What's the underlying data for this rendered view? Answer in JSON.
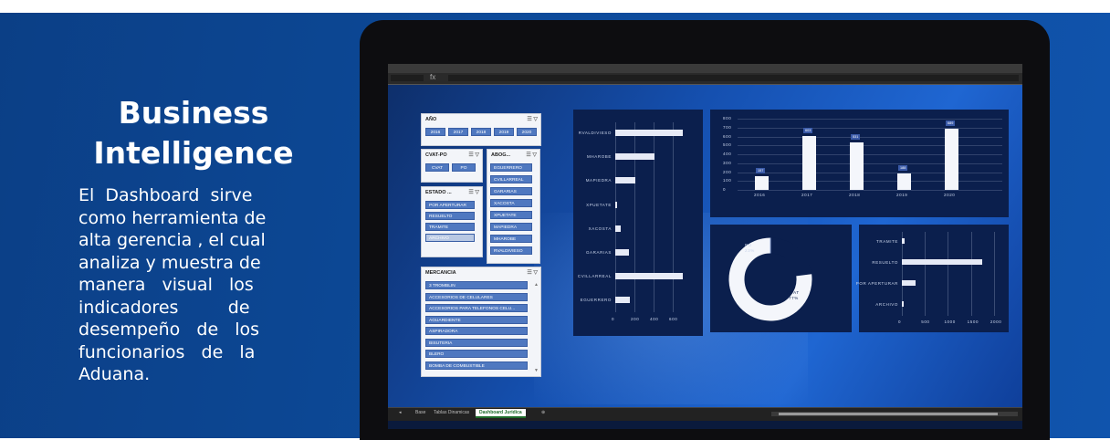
{
  "slide": {
    "title_line1": "Business",
    "title_line2": "Intelligence",
    "description_lines": [
      "El  Dashboard  sirve",
      "como herramienta de",
      "alta gerencia , el cual",
      "analiza y muestra de",
      "manera   visual   los",
      "indicadores         de",
      "desempeño   de   los",
      "funcionarios   de   la",
      "Aduana."
    ]
  },
  "excel": {
    "fx_label": "fx",
    "sheet_tabs": [
      "Base",
      "Tablas Dinamicas",
      "Dashboard Juridica"
    ],
    "active_tab": "Dashboard Juridica"
  },
  "slicers": {
    "year": {
      "title": "AÑO",
      "items": [
        "2016",
        "2017",
        "2018",
        "2019",
        "2020"
      ]
    },
    "cvat": {
      "title": "CVAT-PO",
      "items": [
        "CVAT",
        "PO"
      ]
    },
    "abog": {
      "title": "ABOG...",
      "items": [
        "EGUERRERO",
        "CVILLARREAL",
        "GARARIAS",
        "XACOSTA",
        "XPUETATE",
        "MAPIEDRA",
        "MHAROBE",
        "RVALDIVIESO"
      ]
    },
    "estado": {
      "title": "ESTADO ...",
      "items": [
        "POR APERTURAR",
        "RESUELTO",
        "TRAMITE",
        "ARCHIVO"
      ]
    },
    "mercancia": {
      "title": "MERCANCIA",
      "items": [
        "3 TROMBLIN",
        "ACCESORIOS DE CELULARES",
        "ACCESORIOS PARA TELEFONOS CELU...",
        "AGUARDIENTE",
        "ASPIRADORA",
        "BISUTERIA",
        "BLERO",
        "BOMBA DE COMBUSTIBLE"
      ]
    }
  },
  "chart_data": [
    {
      "type": "bar",
      "orientation": "horizontal",
      "categories": [
        "RVALDIVIESO",
        "MHAROBE",
        "MAPIEDRA",
        "XPUETATE",
        "XACOSTA",
        "GARARIAS",
        "CVILLARREAL",
        "EGUERRERO"
      ],
      "values": [
        700,
        410,
        210,
        15,
        55,
        140,
        700,
        150
      ],
      "x_ticks": [
        "0",
        "200",
        "400",
        "600"
      ],
      "xlim": [
        0,
        800
      ]
    },
    {
      "type": "bar",
      "categories": [
        "2016",
        "2017",
        "2018",
        "2019",
        "2020"
      ],
      "values": [
        157,
        603,
        531,
        188,
        689
      ],
      "data_labels": [
        "157",
        "603",
        "531",
        "188",
        "689"
      ],
      "y_ticks": [
        "0",
        "100",
        "200",
        "300",
        "400",
        "500",
        "600",
        "700",
        "800"
      ],
      "ylim": [
        0,
        800
      ]
    },
    {
      "type": "pie",
      "style": "donut",
      "slices": [
        {
          "label": "PO",
          "value_label": "23%",
          "value": 23
        },
        {
          "label": "CVAT",
          "value_label": "77%",
          "value": 77
        }
      ]
    },
    {
      "type": "bar",
      "orientation": "horizontal",
      "categories": [
        "TRAMITE",
        "RESUELTO",
        "POR APERTURAR",
        "ARCHIVO"
      ],
      "values": [
        60,
        1750,
        300,
        5
      ],
      "x_ticks": [
        "0",
        "500",
        "1000",
        "1500",
        "2000"
      ],
      "xlim": [
        0,
        2200
      ]
    }
  ]
}
